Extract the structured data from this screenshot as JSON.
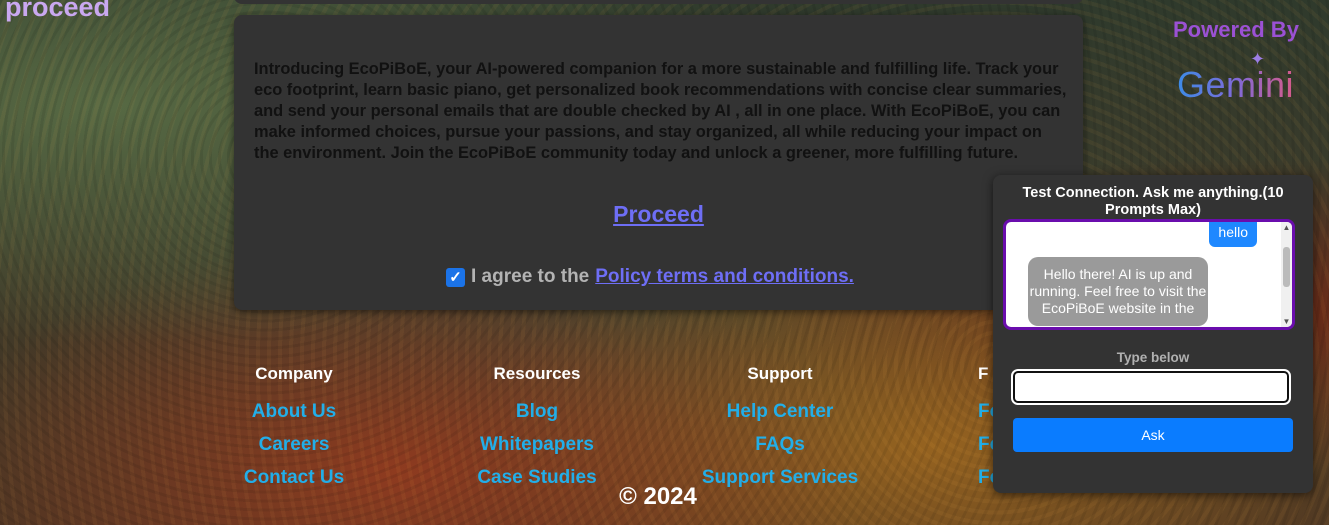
{
  "header": {
    "title": "proceed"
  },
  "intro": {
    "paragraph": "Introducing EcoPiBoE, your AI-powered companion for a more sustainable and fulfilling life. Track your eco footprint, learn basic piano, get personalized book recommendations with concise clear summaries, and send your personal emails that are double checked by AI , all in one place. With EcoPiBoE, you can make informed choices, pursue your passions, and stay organized, all while reducing your impact on the environment. Join the EcoPiBoE community today and unlock a greener, more fulfilling future.",
    "proceed_label": "Proceed",
    "agree_prefix": "I agree to the",
    "agree_link": "Policy terms and conditions.",
    "agree_checked": true
  },
  "branding": {
    "powered_by": "Powered By",
    "logo": "Gemini"
  },
  "footer": {
    "columns": [
      {
        "heading": "Company",
        "links": [
          "About Us",
          "Careers",
          "Contact Us"
        ]
      },
      {
        "heading": "Resources",
        "links": [
          "Blog",
          "Whitepapers",
          "Case Studies"
        ]
      },
      {
        "heading": "Support",
        "links": [
          "Help Center",
          "FAQs",
          "Support Services"
        ]
      },
      {
        "heading": "F",
        "links": [
          "Fo",
          "Fo",
          "Fo"
        ]
      }
    ],
    "copyright": "© 2024"
  },
  "chat": {
    "title": "Test Connection. Ask me anything.(10 Prompts Max)",
    "messages": [
      {
        "role": "user",
        "text": "hello"
      },
      {
        "role": "bot",
        "text": "Hello there! AI is up and running. Feel free to visit the EcoPiBoE website in the"
      }
    ],
    "input_label": "Type below",
    "input_value": "",
    "ask_label": "Ask"
  },
  "colors": {
    "accent_purple": "#9b51d4",
    "link_blue": "#22aee8",
    "link_violet": "#6e6ef5",
    "ask_button": "#0a7cff"
  },
  "icons": {
    "checkbox": "checkmark-icon",
    "sparkle": "sparkle-icon"
  }
}
